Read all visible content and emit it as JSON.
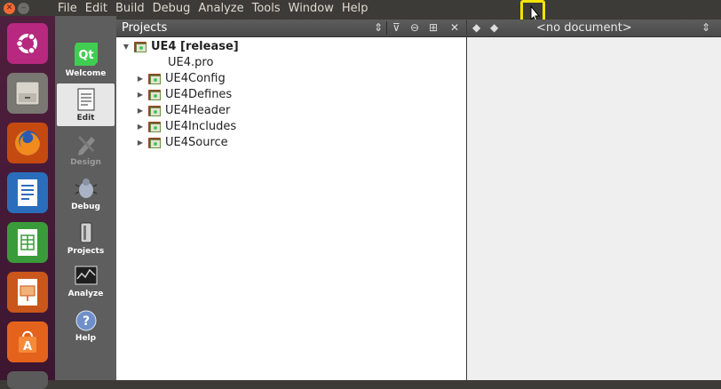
{
  "menu": [
    "File",
    "Edit",
    "Build",
    "Debug",
    "Analyze",
    "Tools",
    "Window",
    "Help"
  ],
  "window_buttons": {
    "close": "close-icon",
    "minimize": "minimize-icon"
  },
  "launcher": [
    {
      "name": "ubuntu-dash",
      "icon": "ubuntu-logo-icon",
      "color": "#b7287f"
    },
    {
      "name": "files",
      "icon": "file-cabinet-icon",
      "color": "#6a6a66"
    },
    {
      "name": "firefox",
      "icon": "firefox-icon",
      "color": "#e66000"
    },
    {
      "name": "libreoffice-writer",
      "icon": "writer-icon",
      "color": "#2a6ebb"
    },
    {
      "name": "libreoffice-calc",
      "icon": "calc-icon",
      "color": "#3a9b3a"
    },
    {
      "name": "libreoffice-impress",
      "icon": "impress-icon",
      "color": "#c9561a"
    },
    {
      "name": "software-center",
      "icon": "shopping-bag-icon",
      "color": "#e4631c"
    }
  ],
  "modes": [
    {
      "label": "Welcome",
      "icon": "qt-logo-icon"
    },
    {
      "label": "Edit",
      "icon": "document-icon",
      "active": true
    },
    {
      "label": "Design",
      "icon": "pencil-icon",
      "disabled": true
    },
    {
      "label": "Debug",
      "icon": "bug-icon"
    },
    {
      "label": "Projects",
      "icon": "wrench-icon"
    },
    {
      "label": "Analyze",
      "icon": "monitor-icon"
    },
    {
      "label": "Help",
      "icon": "help-icon"
    }
  ],
  "projects": {
    "title": "Projects",
    "root": "UE4 [release]",
    "items": [
      "UE4.pro",
      "UE4Config",
      "UE4Defines",
      "UE4Header",
      "UE4Includes",
      "UE4Source"
    ]
  },
  "editor": {
    "document_label": "<no document>"
  },
  "colors": {
    "highlight": "#f2e400",
    "qt_green": "#41cd52"
  }
}
